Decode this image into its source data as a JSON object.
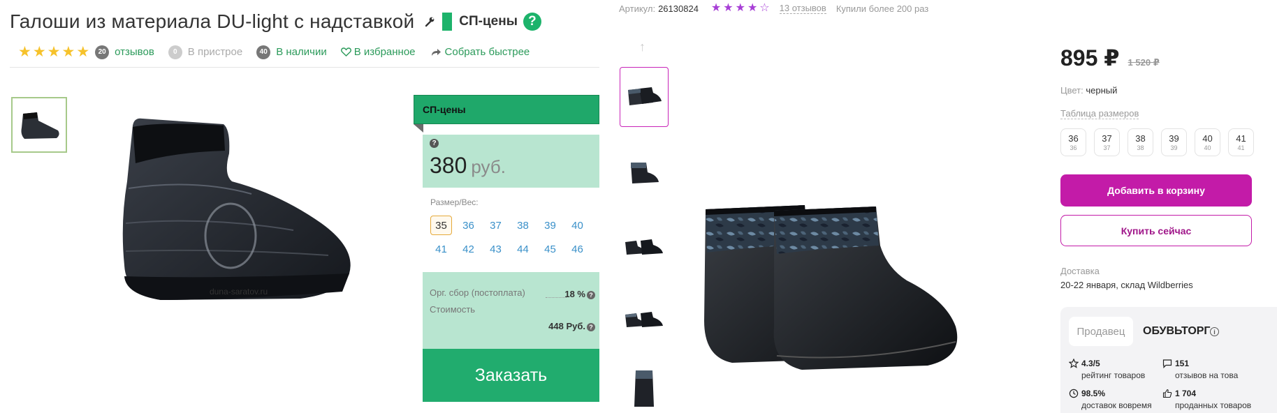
{
  "left": {
    "title": "Галоши из материала DU-light с надставкой",
    "sp_label": "СП-цены",
    "help": "?",
    "meta": {
      "rating": 5,
      "reviews_count": "20",
      "reviews_label": "отзывов",
      "pristroy_count": "0",
      "pristroy_label": "В пристрое",
      "stock_count": "40",
      "stock_label": "В наличии",
      "favorites_label": "В избранное",
      "collect_label": "Собрать быстрее"
    },
    "watermark": "duna-saratov.ru",
    "card": {
      "header": "СП-цены",
      "price": "380",
      "currency": "руб.",
      "size_caption": "Размер/Вес:",
      "sizes": [
        "35",
        "36",
        "37",
        "38",
        "39",
        "40",
        "41",
        "42",
        "43",
        "44",
        "45",
        "46"
      ],
      "selected_size": "35",
      "fee_label": "Орг. сбор (постоплата)",
      "fee_value": "18 %",
      "cost_label": "Стоимость",
      "cost_value": "448 Руб.",
      "order_button": "Заказать"
    }
  },
  "right": {
    "article_label": "Артикул:",
    "article_value": "26130824",
    "rating": 4,
    "reviews": "13 отзывов",
    "bought": "Купили более 200 раз",
    "price": "895 ₽",
    "old_price": "1 520 ₽",
    "color_label": "Цвет:",
    "color_value": "черный",
    "size_table": "Таблица размеров",
    "sizes": [
      {
        "top": "36",
        "bottom": "36"
      },
      {
        "top": "37",
        "bottom": "37"
      },
      {
        "top": "38",
        "bottom": "38"
      },
      {
        "top": "39",
        "bottom": "39"
      },
      {
        "top": "40",
        "bottom": "40"
      },
      {
        "top": "41",
        "bottom": "41"
      }
    ],
    "add_to_cart": "Добавить в корзину",
    "buy_now": "Купить сейчас",
    "delivery_label": "Доставка",
    "delivery_value": "20-22 января, склад Wildberries",
    "seller": {
      "tab": "Продавец",
      "name": "ОБУВЬТОРГ",
      "stats": [
        {
          "icon": "star-outline-icon",
          "value": "4.3/5",
          "label": "рейтинг товаров"
        },
        {
          "icon": "comment-icon",
          "value": "151",
          "label": "отзывов на това"
        },
        {
          "icon": "clock-icon",
          "value": "98.5%",
          "label": "доставок вовремя"
        },
        {
          "icon": "thumb-up-icon",
          "value": "1 704",
          "label": "проданных товаров"
        }
      ]
    }
  },
  "colors": {
    "green": "#1db36b",
    "mint": "#b8e5d0",
    "star_yellow": "#f6c22b",
    "wb_purple": "#c31ba8"
  }
}
